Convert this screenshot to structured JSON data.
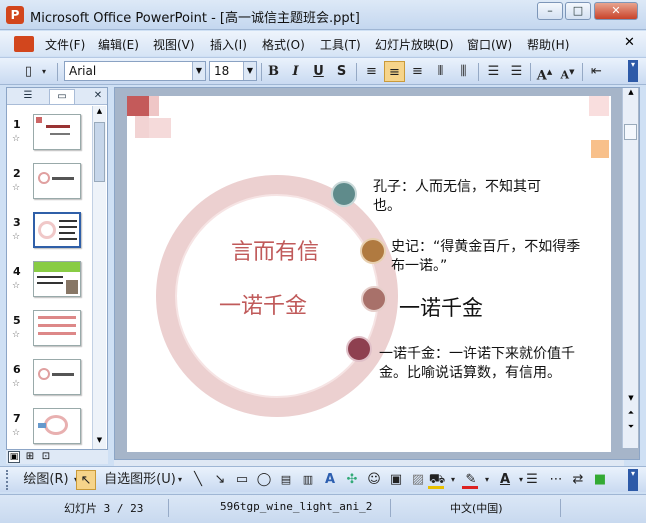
{
  "window": {
    "title": "Microsoft Office PowerPoint - [高一诚信主题班会.ppt]"
  },
  "menu": [
    "文件(F)",
    "编辑(E)",
    "视图(V)",
    "插入(I)",
    "格式(O)",
    "工具(T)",
    "幻灯片放映(D)",
    "窗口(W)",
    "帮助(H)"
  ],
  "toolbar": {
    "font": "Arial",
    "size": "18",
    "bold": "B",
    "italic": "I",
    "underline": "U",
    "shadow": "S"
  },
  "thumbs": [
    {
      "num": "1"
    },
    {
      "num": "2"
    },
    {
      "num": "3"
    },
    {
      "num": "4"
    },
    {
      "num": "5"
    },
    {
      "num": "6"
    },
    {
      "num": "7"
    }
  ],
  "slide": {
    "left_top": "言而有信",
    "left_bottom": "一诺千金",
    "item1": "孔子：人而无信，不知其可也。",
    "item2": "史记：“得黄金百斤，不如得季布一诺。”",
    "item3": "一诺千金",
    "item4": "一诺千金：一许诺下来就价值千金。比喻说话算数，有信用。"
  },
  "drawbar": {
    "draw": "绘图(R)",
    "autoshapes": "自选图形(U)"
  },
  "status": {
    "slide": "幻灯片 3 / 23",
    "template": "596tgp_wine_light_ani_2",
    "language": "中文(中国)"
  },
  "colors": {
    "accent": "#c05a5a",
    "titlebar": "#c4d7ef",
    "tint": "#e8c3c3"
  }
}
